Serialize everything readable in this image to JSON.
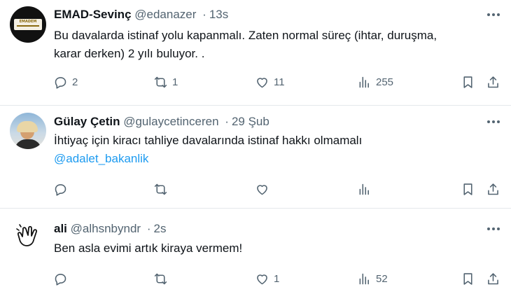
{
  "tweets": [
    {
      "name": "EMAD-Sevinç",
      "handle": "@edanazer",
      "time": "13s",
      "lines": [
        "Bu davalarda istinaf yolu kapanmalı. Zaten normal süreç (ihtar, duruşma,",
        "karar derken) 2 yılı buluyor. ."
      ],
      "counts": {
        "reply": "2",
        "retweet": "1",
        "like": "11",
        "views": "255"
      }
    },
    {
      "name": "Gülay Çetin",
      "handle": "@gulaycetinceren",
      "time": "29 Şub",
      "lines": [
        "İhtiyaç için kiracı tahliye davalarında istinaf hakkı olmamalı"
      ],
      "mention": "@adalet_bakanlik",
      "counts": {
        "reply": "",
        "retweet": "",
        "like": "",
        "views": ""
      }
    },
    {
      "name": "ali",
      "handle": "@alhsnbyndr",
      "time": "2s",
      "lines": [
        "Ben asla evimi artık kiraya vermem!"
      ],
      "counts": {
        "reply": "",
        "retweet": "",
        "like": "1",
        "views": "52"
      }
    }
  ],
  "separator": "·",
  "avatar_text": "EMADEM",
  "colors": {
    "text": "#0f1419",
    "secondary": "#536471",
    "link": "#1d9bf0",
    "divider": "#e4e8eb"
  }
}
